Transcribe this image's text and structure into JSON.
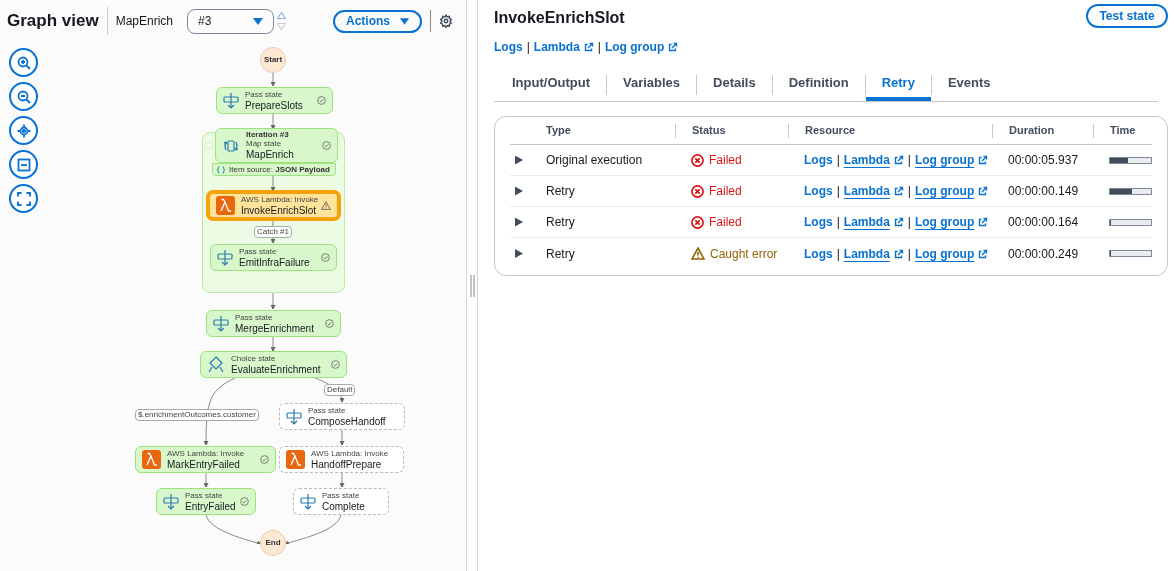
{
  "graph_header": {
    "title": "Graph view",
    "state_name": "MapEnrich",
    "iteration": {
      "value": "#3",
      "previous_disabled": false,
      "next_disabled": true
    },
    "actions_label": "Actions"
  },
  "graph": {
    "start_label": "Start",
    "end_label": "End",
    "nodes": [
      {
        "kind": "pass",
        "type_label": "Pass state",
        "name": "PrepareSlots",
        "executed": true,
        "error": false
      },
      {
        "kind": "map",
        "iteration_label": "Iteration #3",
        "type_label": "Map state",
        "name": "MapEnrich",
        "executed": true,
        "error": false,
        "item_source": "Item source: **JSON Payload**"
      },
      {
        "kind": "lambda",
        "type_label": "AWS Lambda: Invoke",
        "name": "InvokeEnrichSlot",
        "executed": true,
        "error": true,
        "selected": true
      },
      {
        "kind": "pass",
        "type_label": "Pass state",
        "name": "EmitInfraFailure",
        "executed": true,
        "error": false
      },
      {
        "kind": "pass",
        "type_label": "Pass state",
        "name": "MergeEnrichment",
        "executed": true,
        "error": false
      },
      {
        "kind": "choice",
        "type_label": "Choice state",
        "name": "EvaluateEnrichment",
        "executed": true,
        "error": false
      },
      {
        "kind": "pass",
        "type_label": "Pass state",
        "name": "ComposeHandoff",
        "executed": false
      },
      {
        "kind": "lambda",
        "type_label": "AWS Lambda: Invoke",
        "name": "MarkEntryFailed",
        "executed": true,
        "error": false
      },
      {
        "kind": "lambda",
        "type_label": "AWS Lambda: Invoke",
        "name": "HandoffPrepare",
        "executed": false
      },
      {
        "kind": "pass",
        "type_label": "Pass state",
        "name": "EntryFailed",
        "executed": true,
        "error": false
      },
      {
        "kind": "pass",
        "type_label": "Pass state",
        "name": "Complete",
        "executed": false
      }
    ],
    "edge_labels": [
      "Catch #1",
      "Default",
      "$.enrichmentOutcomes.customer"
    ]
  },
  "detail": {
    "title": "InvokeEnrichSlot",
    "test_button": "Test state",
    "separator": "|",
    "links": [
      {
        "label": "Logs",
        "external": false
      },
      {
        "label": "Lambda",
        "external": true
      },
      {
        "label": "Log group",
        "external": true
      }
    ],
    "tabs": [
      {
        "label": "Input/Output",
        "selected": false
      },
      {
        "label": "Variables",
        "selected": false
      },
      {
        "label": "Details",
        "selected": false
      },
      {
        "label": "Definition",
        "selected": false
      },
      {
        "label": "Retry",
        "selected": true
      },
      {
        "label": "Events",
        "selected": false
      }
    ],
    "table": {
      "columns": [
        "Type",
        "Status",
        "Resource",
        "Duration",
        "Time"
      ],
      "rows": [
        {
          "type": "Original execution",
          "status": {
            "kind": "failed",
            "label": "Failed"
          },
          "resources": [
            {
              "label": "Logs",
              "external": false
            },
            {
              "label": "Lambda",
              "external": true
            },
            {
              "label": "Log group",
              "external": true
            }
          ],
          "duration": "00:00:05.937",
          "level": 0.45
        },
        {
          "type": "Retry",
          "status": {
            "kind": "failed",
            "label": "Failed"
          },
          "resources": [
            {
              "label": "Logs",
              "external": false
            },
            {
              "label": "Lambda",
              "external": true
            },
            {
              "label": "Log group",
              "external": true
            }
          ],
          "duration": "00:00:00.149",
          "level": 0.53
        },
        {
          "type": "Retry",
          "status": {
            "kind": "failed",
            "label": "Failed"
          },
          "resources": [
            {
              "label": "Logs",
              "external": false
            },
            {
              "label": "Lambda",
              "external": true
            },
            {
              "label": "Log group",
              "external": true
            }
          ],
          "duration": "00:00:00.164",
          "level": 0.02
        },
        {
          "type": "Retry",
          "status": {
            "kind": "caught",
            "label": "Caught error"
          },
          "resources": [
            {
              "label": "Logs",
              "external": false
            },
            {
              "label": "Lambda",
              "external": true
            },
            {
              "label": "Log group",
              "external": true
            }
          ],
          "duration": "00:00:00.249",
          "level": 0.02
        }
      ]
    }
  }
}
